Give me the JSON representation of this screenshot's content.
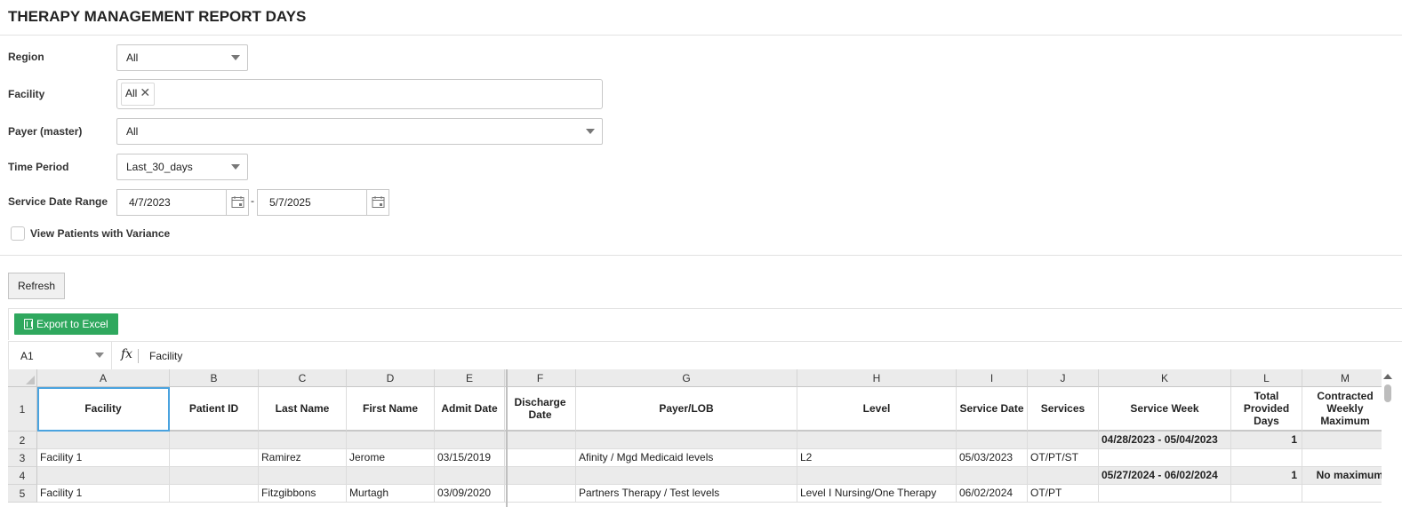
{
  "page": {
    "title": "THERAPY MANAGEMENT REPORT DAYS"
  },
  "filters": {
    "region": {
      "label": "Region",
      "value": "All"
    },
    "facility": {
      "label": "Facility",
      "chip": "All",
      "chip_remove": "✕"
    },
    "payer": {
      "label": "Payer (master)",
      "value": "All"
    },
    "time_period": {
      "label": "Time Period",
      "value": "Last_30_days"
    },
    "service_date_range": {
      "label": "Service Date Range",
      "start": "4/7/2023",
      "separator": "-",
      "end": "5/7/2025"
    },
    "variance": {
      "label": "View Patients with Variance",
      "checked": false
    }
  },
  "actions": {
    "refresh": "Refresh",
    "export": "Export to Excel"
  },
  "formula_bar": {
    "name_box": "A1",
    "fx": "fx",
    "value": "Facility"
  },
  "grid": {
    "columns": [
      {
        "letter": "A",
        "header": "Facility"
      },
      {
        "letter": "B",
        "header": "Patient ID"
      },
      {
        "letter": "C",
        "header": "Last Name"
      },
      {
        "letter": "D",
        "header": "First Name"
      },
      {
        "letter": "E",
        "header": "Admit Date"
      },
      {
        "letter": "F",
        "header": "Discharge Date"
      },
      {
        "letter": "G",
        "header": "Payer/LOB"
      },
      {
        "letter": "H",
        "header": "Level"
      },
      {
        "letter": "I",
        "header": "Service Date"
      },
      {
        "letter": "J",
        "header": "Services"
      },
      {
        "letter": "K",
        "header": "Service Week"
      },
      {
        "letter": "L",
        "header": "Total Provided Days"
      },
      {
        "letter": "M",
        "header": "Contracted Weekly Maximum"
      }
    ],
    "row_numbers": [
      "1",
      "2",
      "3",
      "4",
      "5"
    ],
    "rows": [
      {
        "group": true,
        "cells": [
          "",
          "",
          "",
          "",
          "",
          "",
          "",
          "",
          "",
          "",
          "04/28/2023 - 05/04/2023",
          "1",
          ""
        ]
      },
      {
        "group": false,
        "cells": [
          "Facility 1",
          "",
          "Ramirez",
          "Jerome",
          "03/15/2019",
          "",
          "Afinity   / Mgd Medicaid levels",
          "L2",
          "05/03/2023",
          "OT/PT/ST",
          "",
          "",
          ""
        ]
      },
      {
        "group": true,
        "cells": [
          "",
          "",
          "",
          "",
          "",
          "",
          "",
          "",
          "",
          "",
          "05/27/2024 - 06/02/2024",
          "1",
          "No maximum"
        ]
      },
      {
        "group": false,
        "cells": [
          "Facility 1",
          "",
          "Fitzgibbons",
          "Murtagh",
          "03/09/2020",
          "",
          "Partners Therapy  / Test levels",
          "Level I Nursing/One Therapy",
          "06/02/2024",
          "OT/PT",
          "",
          "",
          ""
        ]
      }
    ]
  }
}
